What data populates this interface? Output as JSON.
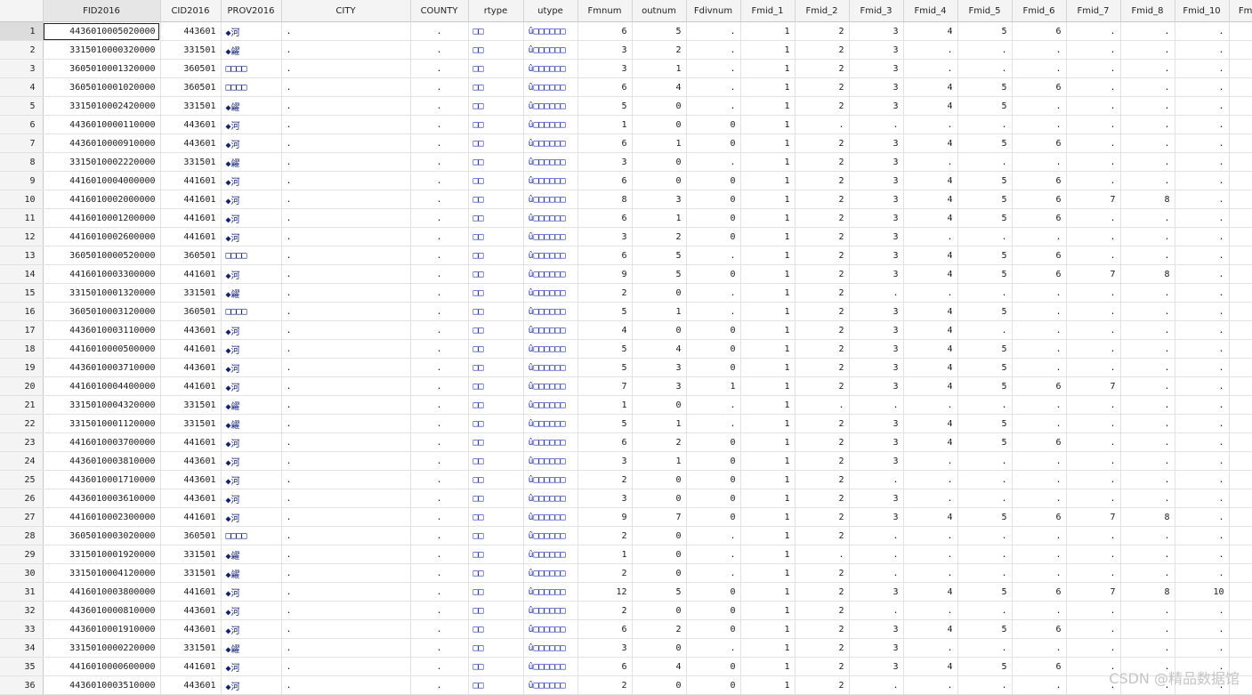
{
  "columns": [
    "",
    "FID2016",
    "CID2016",
    "PROV2016",
    "CITY",
    "COUNTY",
    "rtype",
    "utype",
    "Fmnum",
    "outnum",
    "Fdivnum",
    "Fmid_1",
    "Fmid_2",
    "Fmid_3",
    "Fmid_4",
    "Fmid_5",
    "Fmid_6",
    "Fmid_7",
    "Fmid_8",
    "Fmid_10",
    "Fmi"
  ],
  "sorted_column": "FID2016",
  "rows": [
    [
      "1",
      "4436010005020000",
      "443601",
      "◆河",
      "",
      "",
      "□□",
      "û□□□□□□",
      "6",
      "5",
      ".",
      "1",
      "2",
      "3",
      "4",
      "5",
      "6",
      ".",
      ".",
      "."
    ],
    [
      "2",
      "3315010000320000",
      "331501",
      "◆糴",
      "",
      "",
      "□□",
      "û□□□□□□",
      "3",
      "2",
      ".",
      "1",
      "2",
      "3",
      ".",
      ".",
      ".",
      ".",
      ".",
      "."
    ],
    [
      "3",
      "3605010001320000",
      "360501",
      "□□□□",
      "",
      "",
      "□□",
      "û□□□□□□",
      "3",
      "1",
      ".",
      "1",
      "2",
      "3",
      ".",
      ".",
      ".",
      ".",
      ".",
      "."
    ],
    [
      "4",
      "3605010001020000",
      "360501",
      "□□□□",
      "",
      "",
      "□□",
      "û□□□□□□",
      "6",
      "4",
      ".",
      "1",
      "2",
      "3",
      "4",
      "5",
      "6",
      ".",
      ".",
      "."
    ],
    [
      "5",
      "3315010002420000",
      "331501",
      "◆糴",
      "",
      "",
      "□□",
      "û□□□□□□",
      "5",
      "0",
      ".",
      "1",
      "2",
      "3",
      "4",
      "5",
      ".",
      ".",
      ".",
      "."
    ],
    [
      "6",
      "4436010000110000",
      "443601",
      "◆河",
      "",
      "",
      "□□",
      "û□□□□□□",
      "1",
      "0",
      "0",
      "1",
      ".",
      ".",
      ".",
      ".",
      ".",
      ".",
      ".",
      "."
    ],
    [
      "7",
      "4436010000910000",
      "443601",
      "◆河",
      "",
      "",
      "□□",
      "û□□□□□□",
      "6",
      "1",
      "0",
      "1",
      "2",
      "3",
      "4",
      "5",
      "6",
      ".",
      ".",
      "."
    ],
    [
      "8",
      "3315010002220000",
      "331501",
      "◆糴",
      "",
      "",
      "□□",
      "û□□□□□□",
      "3",
      "0",
      ".",
      "1",
      "2",
      "3",
      ".",
      ".",
      ".",
      ".",
      ".",
      "."
    ],
    [
      "9",
      "4416010004000000",
      "441601",
      "◆河",
      "",
      "",
      "□□",
      "û□□□□□□",
      "6",
      "0",
      "0",
      "1",
      "2",
      "3",
      "4",
      "5",
      "6",
      ".",
      ".",
      "."
    ],
    [
      "10",
      "4416010002000000",
      "441601",
      "◆河",
      "",
      "",
      "□□",
      "û□□□□□□",
      "8",
      "3",
      "0",
      "1",
      "2",
      "3",
      "4",
      "5",
      "6",
      "7",
      "8",
      "."
    ],
    [
      "11",
      "4416010001200000",
      "441601",
      "◆河",
      "",
      "",
      "□□",
      "û□□□□□□",
      "6",
      "1",
      "0",
      "1",
      "2",
      "3",
      "4",
      "5",
      "6",
      ".",
      ".",
      "."
    ],
    [
      "12",
      "4416010002600000",
      "441601",
      "◆河",
      "",
      "",
      "□□",
      "û□□□□□□",
      "3",
      "2",
      "0",
      "1",
      "2",
      "3",
      ".",
      ".",
      ".",
      ".",
      ".",
      "."
    ],
    [
      "13",
      "3605010000520000",
      "360501",
      "□□□□",
      "",
      "",
      "□□",
      "û□□□□□□",
      "6",
      "5",
      ".",
      "1",
      "2",
      "3",
      "4",
      "5",
      "6",
      ".",
      ".",
      "."
    ],
    [
      "14",
      "4416010003300000",
      "441601",
      "◆河",
      "",
      "",
      "□□",
      "û□□□□□□",
      "9",
      "5",
      "0",
      "1",
      "2",
      "3",
      "4",
      "5",
      "6",
      "7",
      "8",
      "."
    ],
    [
      "15",
      "3315010001320000",
      "331501",
      "◆糴",
      "",
      "",
      "□□",
      "û□□□□□□",
      "2",
      "0",
      ".",
      "1",
      "2",
      ".",
      ".",
      ".",
      ".",
      ".",
      ".",
      "."
    ],
    [
      "16",
      "3605010003120000",
      "360501",
      "□□□□",
      "",
      "",
      "□□",
      "û□□□□□□",
      "5",
      "1",
      ".",
      "1",
      "2",
      "3",
      "4",
      "5",
      ".",
      ".",
      ".",
      "."
    ],
    [
      "17",
      "4436010003110000",
      "443601",
      "◆河",
      "",
      "",
      "□□",
      "û□□□□□□",
      "4",
      "0",
      "0",
      "1",
      "2",
      "3",
      "4",
      ".",
      ".",
      ".",
      ".",
      "."
    ],
    [
      "18",
      "4416010000500000",
      "441601",
      "◆河",
      "",
      "",
      "□□",
      "û□□□□□□",
      "5",
      "4",
      "0",
      "1",
      "2",
      "3",
      "4",
      "5",
      ".",
      ".",
      ".",
      "."
    ],
    [
      "19",
      "4436010003710000",
      "443601",
      "◆河",
      "",
      "",
      "□□",
      "û□□□□□□",
      "5",
      "3",
      "0",
      "1",
      "2",
      "3",
      "4",
      "5",
      ".",
      ".",
      ".",
      "."
    ],
    [
      "20",
      "4416010004400000",
      "441601",
      "◆河",
      "",
      "",
      "□□",
      "û□□□□□□",
      "7",
      "3",
      "1",
      "1",
      "2",
      "3",
      "4",
      "5",
      "6",
      "7",
      ".",
      "."
    ],
    [
      "21",
      "3315010004320000",
      "331501",
      "◆糴",
      "",
      "",
      "□□",
      "û□□□□□□",
      "1",
      "0",
      ".",
      "1",
      ".",
      ".",
      ".",
      ".",
      ".",
      ".",
      ".",
      "."
    ],
    [
      "22",
      "3315010001120000",
      "331501",
      "◆糴",
      "",
      "",
      "□□",
      "û□□□□□□",
      "5",
      "1",
      ".",
      "1",
      "2",
      "3",
      "4",
      "5",
      ".",
      ".",
      ".",
      "."
    ],
    [
      "23",
      "4416010003700000",
      "441601",
      "◆河",
      "",
      "",
      "□□",
      "û□□□□□□",
      "6",
      "2",
      "0",
      "1",
      "2",
      "3",
      "4",
      "5",
      "6",
      ".",
      ".",
      "."
    ],
    [
      "24",
      "4436010003810000",
      "443601",
      "◆河",
      "",
      "",
      "□□",
      "û□□□□□□",
      "3",
      "1",
      "0",
      "1",
      "2",
      "3",
      ".",
      ".",
      ".",
      ".",
      ".",
      "."
    ],
    [
      "25",
      "4436010001710000",
      "443601",
      "◆河",
      "",
      "",
      "□□",
      "û□□□□□□",
      "2",
      "0",
      "0",
      "1",
      "2",
      ".",
      ".",
      ".",
      ".",
      ".",
      ".",
      "."
    ],
    [
      "26",
      "4436010003610000",
      "443601",
      "◆河",
      "",
      "",
      "□□",
      "û□□□□□□",
      "3",
      "0",
      "0",
      "1",
      "2",
      "3",
      ".",
      ".",
      ".",
      ".",
      ".",
      "."
    ],
    [
      "27",
      "4416010002300000",
      "441601",
      "◆河",
      "",
      "",
      "□□",
      "û□□□□□□",
      "9",
      "7",
      "0",
      "1",
      "2",
      "3",
      "4",
      "5",
      "6",
      "7",
      "8",
      "."
    ],
    [
      "28",
      "3605010003020000",
      "360501",
      "□□□□",
      "",
      "",
      "□□",
      "û□□□□□□",
      "2",
      "0",
      ".",
      "1",
      "2",
      ".",
      ".",
      ".",
      ".",
      ".",
      ".",
      "."
    ],
    [
      "29",
      "3315010001920000",
      "331501",
      "◆糴",
      "",
      "",
      "□□",
      "û□□□□□□",
      "1",
      "0",
      ".",
      "1",
      ".",
      ".",
      ".",
      ".",
      ".",
      ".",
      ".",
      "."
    ],
    [
      "30",
      "3315010004120000",
      "331501",
      "◆糴",
      "",
      "",
      "□□",
      "û□□□□□□",
      "2",
      "0",
      ".",
      "1",
      "2",
      ".",
      ".",
      ".",
      ".",
      ".",
      ".",
      "."
    ],
    [
      "31",
      "4416010003800000",
      "441601",
      "◆河",
      "",
      "",
      "□□",
      "û□□□□□□",
      "12",
      "5",
      "0",
      "1",
      "2",
      "3",
      "4",
      "5",
      "6",
      "7",
      "8",
      "10"
    ],
    [
      "32",
      "4436010000810000",
      "443601",
      "◆河",
      "",
      "",
      "□□",
      "û□□□□□□",
      "2",
      "0",
      "0",
      "1",
      "2",
      ".",
      ".",
      ".",
      ".",
      ".",
      ".",
      "."
    ],
    [
      "33",
      "4436010001910000",
      "443601",
      "◆河",
      "",
      "",
      "□□",
      "û□□□□□□",
      "6",
      "2",
      "0",
      "1",
      "2",
      "3",
      "4",
      "5",
      "6",
      ".",
      ".",
      "."
    ],
    [
      "34",
      "3315010000220000",
      "331501",
      "◆糴",
      "",
      "",
      "□□",
      "û□□□□□□",
      "3",
      "0",
      ".",
      "1",
      "2",
      "3",
      ".",
      ".",
      ".",
      ".",
      ".",
      "."
    ],
    [
      "35",
      "4416010000600000",
      "441601",
      "◆河",
      "",
      "",
      "□□",
      "û□□□□□□",
      "6",
      "4",
      "0",
      "1",
      "2",
      "3",
      "4",
      "5",
      "6",
      ".",
      ".",
      "."
    ],
    [
      "36",
      "4436010003510000",
      "443601",
      "◆河",
      "",
      "",
      "□□",
      "û□□□□□□",
      "2",
      "0",
      "0",
      "1",
      "2",
      ".",
      ".",
      ".",
      ".",
      ".",
      ".",
      "."
    ]
  ],
  "missing_marker": ".",
  "watermark": "CSDN @精品数据馆",
  "colors": {
    "label_blue": "#1b2bbf",
    "header_bg": "#f4f4f4",
    "grid_line": "#e2e2e2"
  }
}
